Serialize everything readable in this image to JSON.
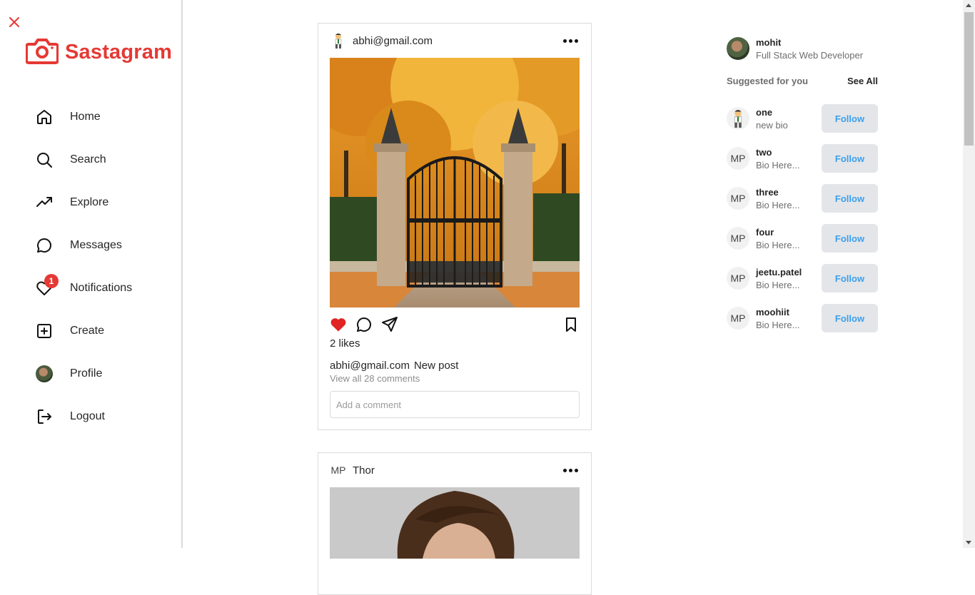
{
  "app": {
    "brand": "Sastagram",
    "accent": "#e53935"
  },
  "sidebar": {
    "items": [
      {
        "label": "Home",
        "icon": "home-icon"
      },
      {
        "label": "Search",
        "icon": "search-icon"
      },
      {
        "label": "Explore",
        "icon": "trending-up-icon"
      },
      {
        "label": "Messages",
        "icon": "message-circle-icon"
      },
      {
        "label": "Notifications",
        "icon": "heart-icon",
        "badge": "1"
      },
      {
        "label": "Create",
        "icon": "plus-square-icon"
      },
      {
        "label": "Profile",
        "icon": "avatar"
      },
      {
        "label": "Logout",
        "icon": "logout-icon"
      }
    ]
  },
  "feed": {
    "posts": [
      {
        "user": "abhi@gmail.com",
        "likes": "2 likes",
        "caption_user": "abhi@gmail.com",
        "caption_text": "New post",
        "view_comments": "View all 28 comments",
        "comment_placeholder": "Add a comment",
        "liked": true
      },
      {
        "user": "Thor",
        "avatar_initials": "MP"
      }
    ]
  },
  "right": {
    "current_user": {
      "name": "mohit",
      "bio": "Full Stack Web Developer"
    },
    "suggested_title": "Suggested for you",
    "see_all": "See All",
    "suggestions": [
      {
        "name": "one",
        "bio": "new bio",
        "avatar": "cartoon",
        "follow_label": "Follow"
      },
      {
        "name": "two",
        "bio": "Bio Here...",
        "avatar": "MP",
        "follow_label": "Follow"
      },
      {
        "name": "three",
        "bio": "Bio Here...",
        "avatar": "MP",
        "follow_label": "Follow"
      },
      {
        "name": "four",
        "bio": "Bio Here...",
        "avatar": "MP",
        "follow_label": "Follow"
      },
      {
        "name": "jeetu.patel",
        "bio": "Bio Here...",
        "avatar": "MP",
        "follow_label": "Follow"
      },
      {
        "name": "moohiit",
        "bio": "Bio Here...",
        "avatar": "MP",
        "follow_label": "Follow"
      }
    ]
  }
}
